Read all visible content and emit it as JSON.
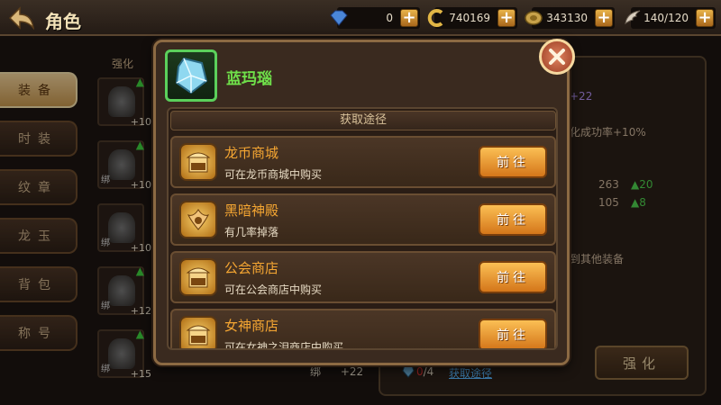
{
  "header": {
    "title": "角色",
    "resources": [
      {
        "name": "diamond",
        "value": "0",
        "icon": "diamond-icon"
      },
      {
        "name": "gold-coin",
        "value": "740169",
        "icon": "coin-c-icon"
      },
      {
        "name": "dragon-coin",
        "value": "343130",
        "icon": "dragon-coin-icon"
      },
      {
        "name": "stamina",
        "value": "140/120",
        "icon": "wing-icon"
      }
    ]
  },
  "tabs": [
    {
      "label": "装备",
      "active": true
    },
    {
      "label": "时装",
      "active": false
    },
    {
      "label": "纹章",
      "active": false
    },
    {
      "label": "龙玉",
      "active": false
    },
    {
      "label": "背包",
      "active": false
    },
    {
      "label": "称号",
      "active": false
    }
  ],
  "background": {
    "strengthen_partial": "强化",
    "equip_slots": [
      {
        "level": "+10",
        "bind": ""
      },
      {
        "level": "+10",
        "bind": "绑"
      },
      {
        "level": "+10",
        "bind": "绑"
      },
      {
        "level": "+12",
        "bind": "绑"
      },
      {
        "level": "+15",
        "bind": "绑"
      }
    ],
    "bottom_bind": "绑",
    "bottom_level": "+22",
    "stat_bonus": "+22",
    "success_rate": "化成功率+10%",
    "stat1_value": "263",
    "stat1_gain": "20",
    "stat2_value": "105",
    "stat2_gain": "8",
    "transfer_text": "到其他装备",
    "material_have": "0",
    "material_need": "/4",
    "get_link": "获取途径",
    "enhance_button": "强化"
  },
  "popup": {
    "item_name": "蓝玛瑙",
    "section_title": "获取途径",
    "sources": [
      {
        "title": "龙币商城",
        "desc": "可在龙币商城中购买",
        "icon": "shop-icon",
        "icon_label": "商店",
        "button": "前往"
      },
      {
        "title": "黑暗神殿",
        "desc": "有几率掉落",
        "icon": "dark-temple-icon",
        "icon_label": "",
        "button": "前往"
      },
      {
        "title": "公会商店",
        "desc": "可在公会商店中购买",
        "icon": "shop-icon",
        "icon_label": "商店",
        "button": "前往"
      },
      {
        "title": "女神商店",
        "desc": "可在女神之泪商店中购买",
        "icon": "shop-icon",
        "icon_label": "商店",
        "button": "前往"
      }
    ]
  },
  "colors": {
    "item_name": "#6fe04a",
    "source_title": "#f5a632",
    "go_button": "#e8952e"
  }
}
